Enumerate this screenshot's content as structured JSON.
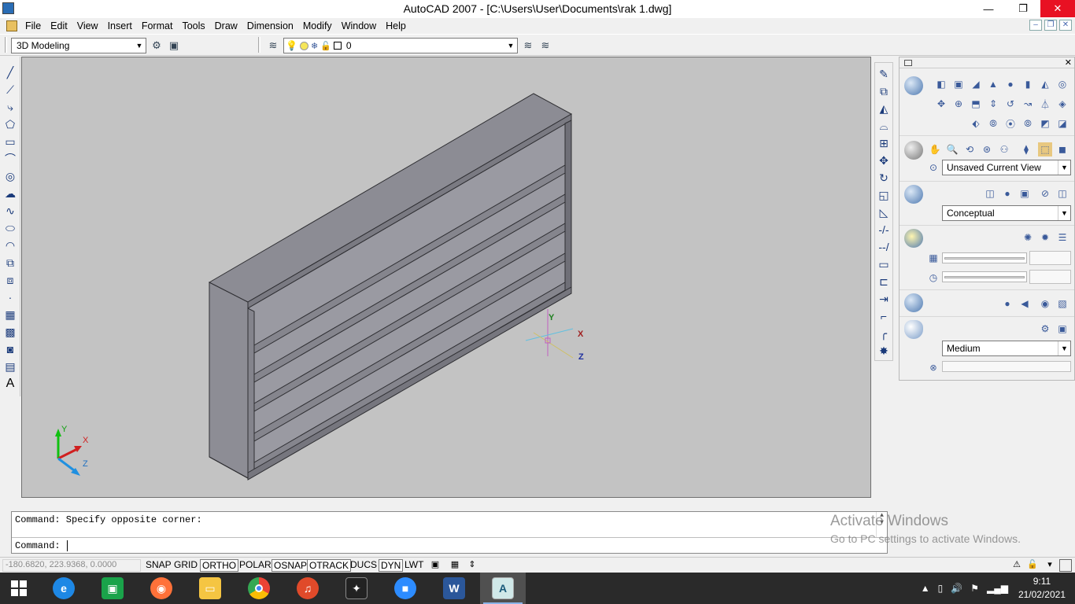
{
  "window": {
    "title": "AutoCAD 2007 - [C:\\Users\\User\\Documents\\rak 1.dwg]",
    "minimize": "—",
    "restore": "❐",
    "close": "✕"
  },
  "menu": {
    "items": [
      "File",
      "Edit",
      "View",
      "Insert",
      "Format",
      "Tools",
      "Draw",
      "Dimension",
      "Modify",
      "Window",
      "Help"
    ]
  },
  "toolbar": {
    "workspace": "3D Modeling",
    "layer": "0"
  },
  "canvas": {
    "ucs_icon_labels": {
      "x": "X",
      "y": "Y",
      "z": "Z"
    },
    "ucs_world_labels": {
      "x": "X",
      "y": "Y",
      "z": "Z"
    }
  },
  "dashboard": {
    "view_combo": "Unsaved Current View",
    "visual_style": "Conceptual",
    "render_quality": "Medium"
  },
  "command": {
    "history": "Command: Specify opposite corner:",
    "prompt": "Command:"
  },
  "watermark": {
    "title": "Activate Windows",
    "subtitle": "Go to PC settings to activate Windows."
  },
  "status": {
    "coords": "-180.6820, 223.9368, 0.0000",
    "buttons": [
      "SNAP",
      "GRID",
      "ORTHO",
      "POLAR",
      "OSNAP",
      "OTRACK",
      "DUCS",
      "DYN",
      "LWT"
    ]
  },
  "taskbar": {
    "time": "9:11",
    "date": "21/02/2021"
  },
  "colors": {
    "canvas_bg": "#c3c3c3",
    "model_face": "#8c8c94",
    "taskbar": "#2a2a2a"
  }
}
